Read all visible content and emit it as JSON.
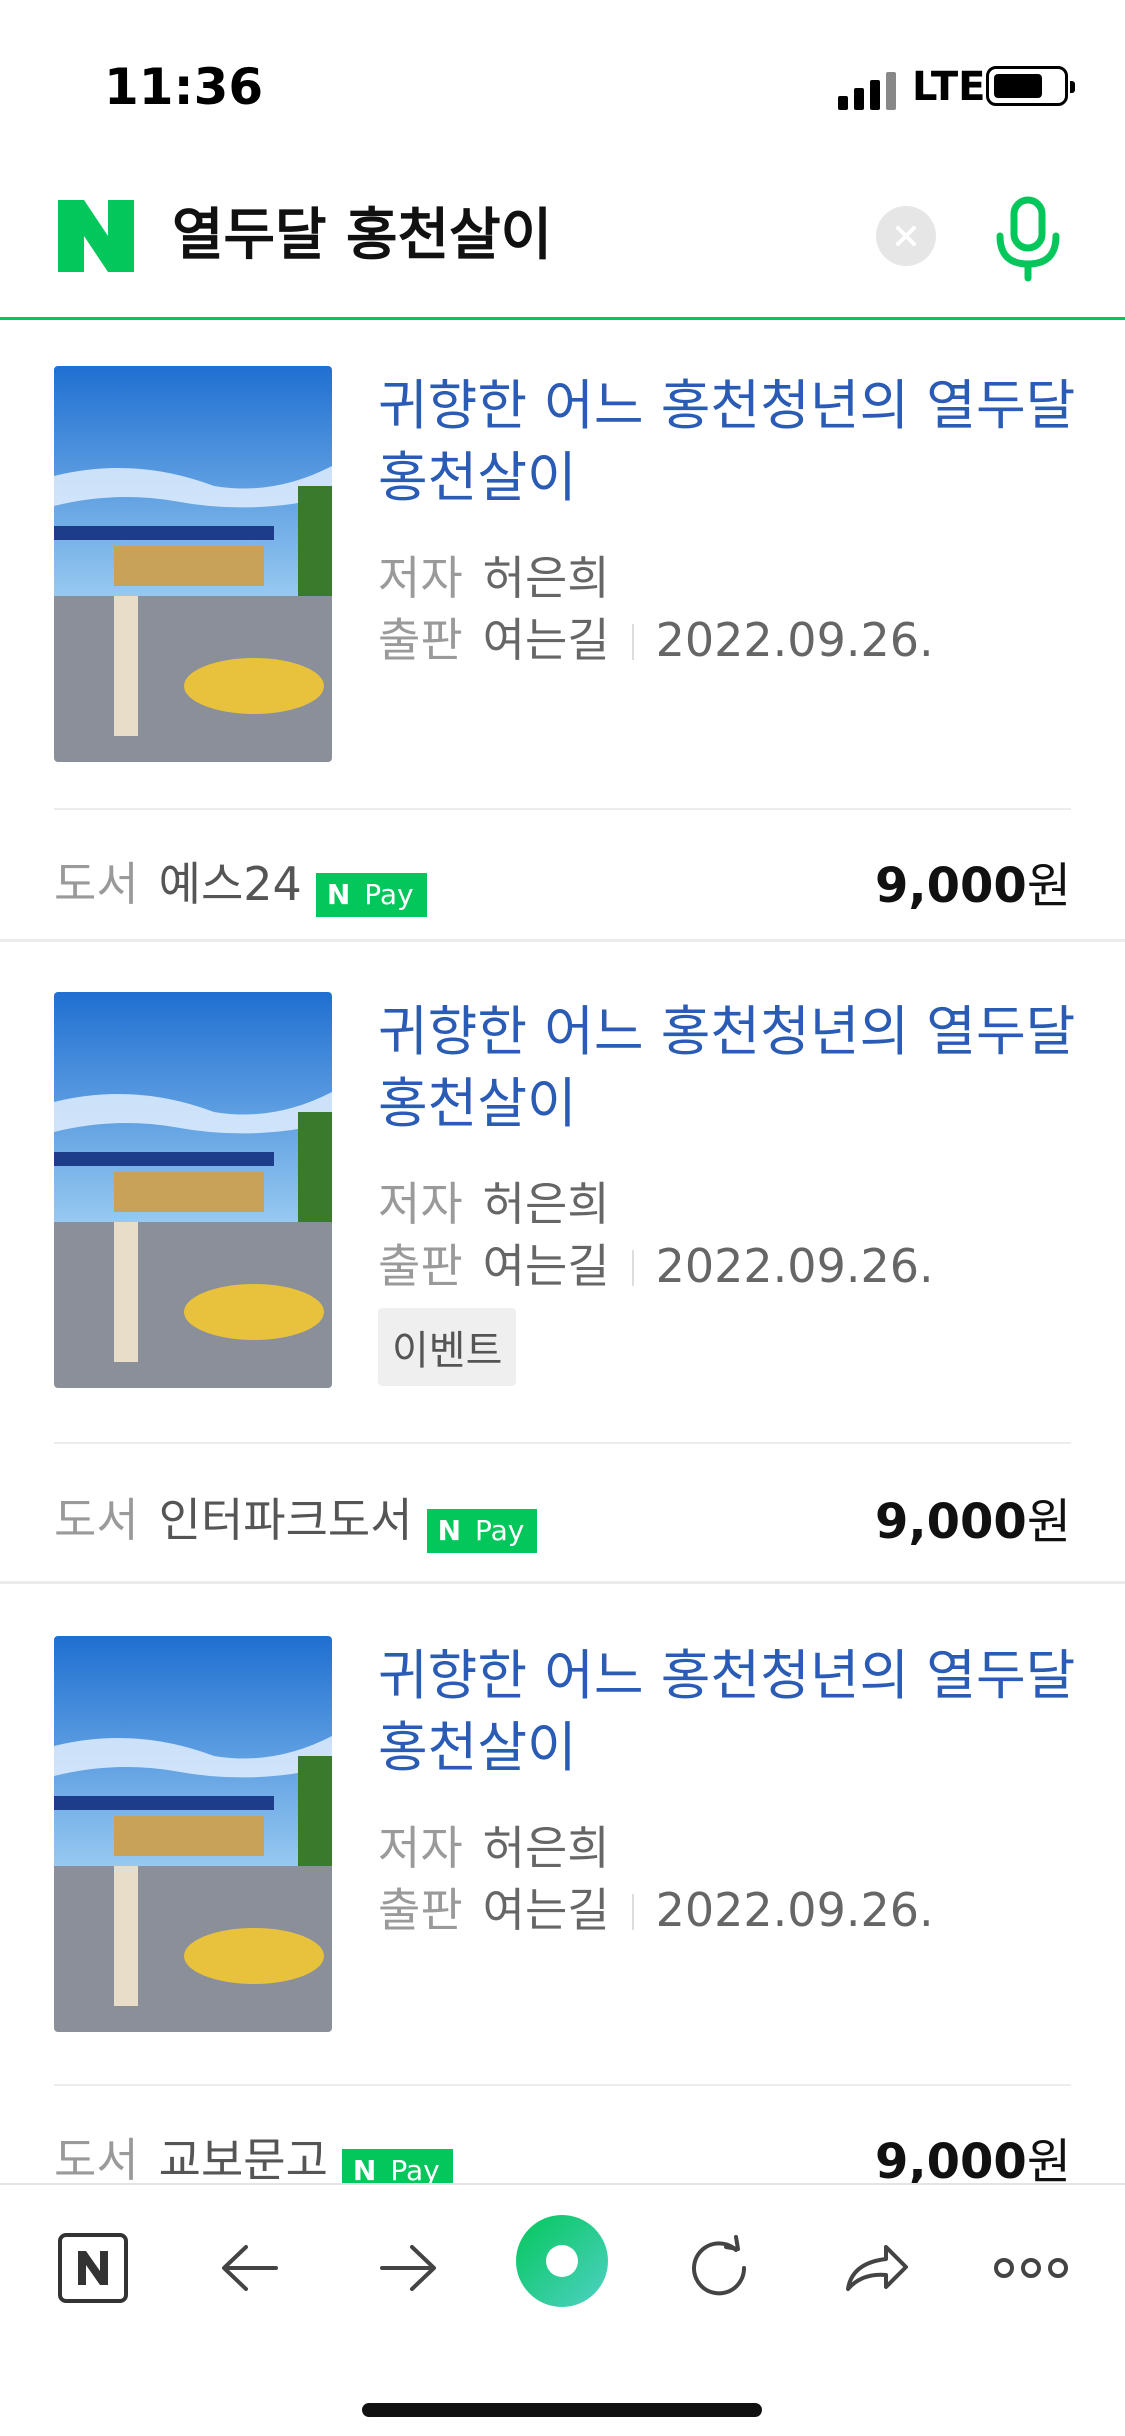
{
  "status_bar": {
    "time": "11:36",
    "network": "LTE"
  },
  "search": {
    "query": "열두달 홍천살이",
    "brand": "N"
  },
  "results": [
    {
      "title_line1": "귀향한 어느 홍천청년의 열두달",
      "title_line2": "홍천살이",
      "author_label": "저자",
      "author": "허은희",
      "publisher_label": "출판",
      "publisher": "여는길",
      "date": "2022.09.26.",
      "category": "도서",
      "store": "예스24",
      "npay": {
        "n": "N",
        "pay": "Pay"
      },
      "price_number": "9,000",
      "price_unit": "원"
    },
    {
      "title_line1": "귀향한 어느 홍천청년의 열두달",
      "title_line2": "홍천살이",
      "author_label": "저자",
      "author": "허은희",
      "publisher_label": "출판",
      "publisher": "여는길",
      "date": "2022.09.26.",
      "badge": "이벤트",
      "category": "도서",
      "store": "인터파크도서",
      "npay": {
        "n": "N",
        "pay": "Pay"
      },
      "price_number": "9,000",
      "price_unit": "원"
    },
    {
      "title_line1": "귀향한 어느 홍천청년의 열두달",
      "title_line2": "홍천살이",
      "author_label": "저자",
      "author": "허은희",
      "publisher_label": "출판",
      "publisher": "여는길",
      "date": "2022.09.26.",
      "category": "도서",
      "store": "교보문고",
      "npay": {
        "n": "N",
        "pay": "Pay"
      },
      "price_number": "9,000",
      "price_unit": "원"
    }
  ],
  "colors": {
    "brand_green": "#03c75a",
    "link_blue": "#2a5bb5"
  },
  "toolbar": {
    "icons": [
      "naver-home-icon",
      "back-arrow-icon",
      "forward-arrow-icon",
      "green-dot-icon",
      "refresh-icon",
      "share-icon",
      "more-icon"
    ]
  }
}
